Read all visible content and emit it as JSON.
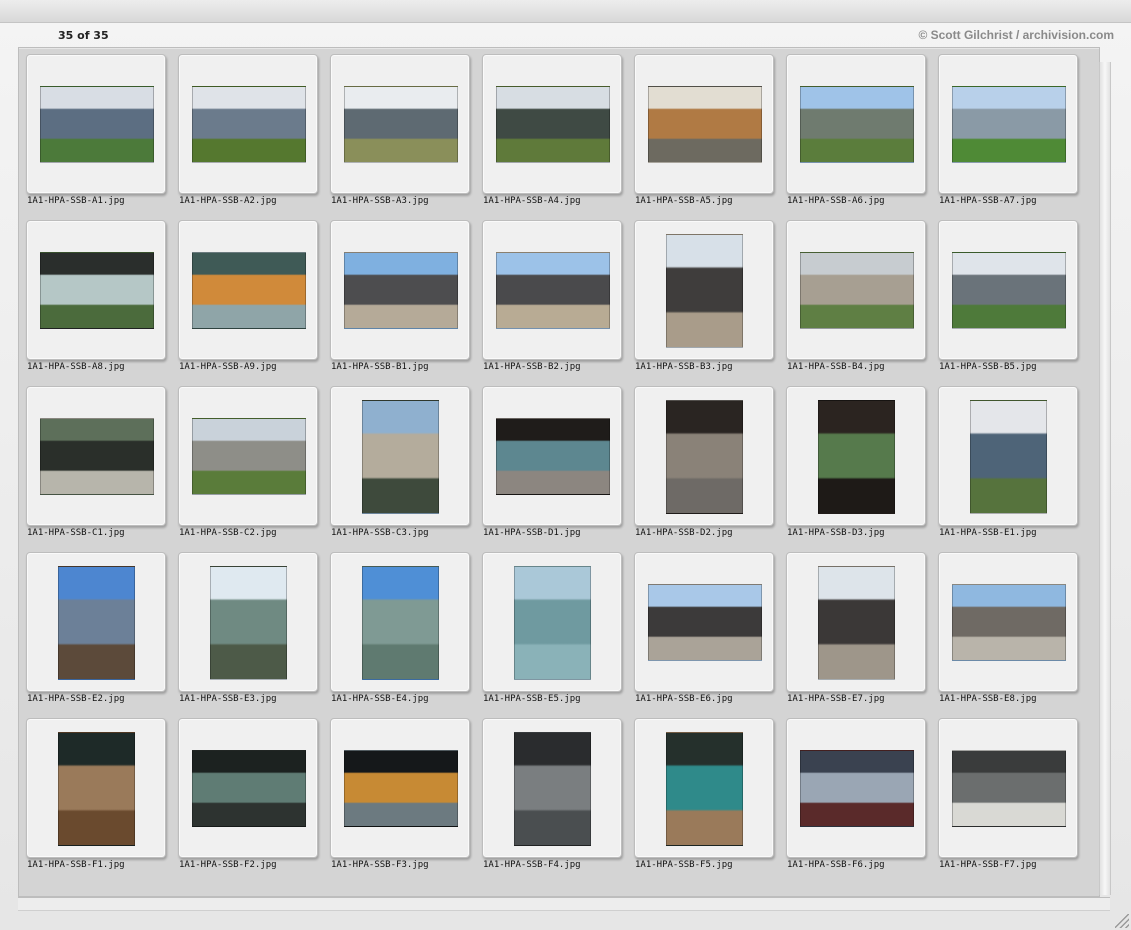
{
  "header": {
    "count": "35 of 35",
    "credit": "© Scott Gilchrist / archivision.com"
  },
  "items": [
    {
      "file": "1A1-HPA-SSB-A1.jpg",
      "orient": "landscape",
      "icon": "building-photo-icon",
      "c": [
        "#d8dde4",
        "#5c6e82",
        "#4c7a3a"
      ]
    },
    {
      "file": "1A1-HPA-SSB-A2.jpg",
      "orient": "landscape",
      "icon": "building-photo-icon",
      "c": [
        "#dfe3e8",
        "#6b7b8c",
        "#55782f"
      ]
    },
    {
      "file": "1A1-HPA-SSB-A3.jpg",
      "orient": "landscape",
      "icon": "walkway-photo-icon",
      "c": [
        "#e9ecef",
        "#5e6a72",
        "#8a8f5a"
      ]
    },
    {
      "file": "1A1-HPA-SSB-A4.jpg",
      "orient": "landscape",
      "icon": "walkway-photo-icon",
      "c": [
        "#d7dde3",
        "#3f4a44",
        "#5f7a3a"
      ]
    },
    {
      "file": "1A1-HPA-SSB-A5.jpg",
      "orient": "landscape",
      "icon": "corridor-photo-icon",
      "c": [
        "#e2ddd2",
        "#b07a44",
        "#6d6a60"
      ]
    },
    {
      "file": "1A1-HPA-SSB-A6.jpg",
      "orient": "landscape",
      "icon": "courtyard-photo-icon",
      "c": [
        "#9fc3e8",
        "#6f7b6f",
        "#5b7d3c"
      ]
    },
    {
      "file": "1A1-HPA-SSB-A7.jpg",
      "orient": "landscape",
      "icon": "courtyard-photo-icon",
      "c": [
        "#b8d0ea",
        "#8a9aa6",
        "#4f8a36"
      ]
    },
    {
      "file": "1A1-HPA-SSB-A8.jpg",
      "orient": "landscape",
      "icon": "interior-photo-icon",
      "c": [
        "#2a2e2c",
        "#b5c7c6",
        "#4b6b3c"
      ]
    },
    {
      "file": "1A1-HPA-SSB-A9.jpg",
      "orient": "landscape",
      "icon": "interior-photo-icon",
      "c": [
        "#3f5a56",
        "#d08a3a",
        "#8fa5a8"
      ]
    },
    {
      "file": "1A1-HPA-SSB-B1.jpg",
      "orient": "landscape",
      "icon": "building-photo-icon",
      "c": [
        "#7fb0e0",
        "#4d4d4f",
        "#b5aa98"
      ]
    },
    {
      "file": "1A1-HPA-SSB-B2.jpg",
      "orient": "landscape",
      "icon": "building-photo-icon",
      "c": [
        "#9cc2e8",
        "#4a4a4c",
        "#b8ab94"
      ]
    },
    {
      "file": "1A1-HPA-SSB-B3.jpg",
      "orient": "portrait",
      "icon": "building-photo-icon",
      "c": [
        "#d7e0e8",
        "#3f3d3c",
        "#a99c8a"
      ]
    },
    {
      "file": "1A1-HPA-SSB-B4.jpg",
      "orient": "landscape",
      "icon": "courtyard-photo-icon",
      "c": [
        "#c7ccd0",
        "#a79f92",
        "#5f7f44"
      ]
    },
    {
      "file": "1A1-HPA-SSB-B5.jpg",
      "orient": "landscape",
      "icon": "courtyard-photo-icon",
      "c": [
        "#dfe4ea",
        "#6a737a",
        "#4e7a3a"
      ]
    },
    {
      "file": "1A1-HPA-SSB-C1.jpg",
      "orient": "landscape",
      "icon": "walkway-photo-icon",
      "c": [
        "#5d6f5a",
        "#2a2f2a",
        "#b7b5ab"
      ]
    },
    {
      "file": "1A1-HPA-SSB-C2.jpg",
      "orient": "landscape",
      "icon": "walkway-photo-icon",
      "c": [
        "#c9d2da",
        "#8e8e88",
        "#5a7c3a"
      ]
    },
    {
      "file": "1A1-HPA-SSB-C3.jpg",
      "orient": "portrait",
      "icon": "building-photo-icon",
      "c": [
        "#8fb0cf",
        "#b4ac9c",
        "#3e4a3c"
      ]
    },
    {
      "file": "1A1-HPA-SSB-D1.jpg",
      "orient": "landscape",
      "icon": "building-photo-icon",
      "c": [
        "#1f1c1a",
        "#5d8790",
        "#8c8680"
      ]
    },
    {
      "file": "1A1-HPA-SSB-D2.jpg",
      "orient": "portrait",
      "icon": "corridor-photo-icon",
      "c": [
        "#2a2522",
        "#8a8278",
        "#6e6a66"
      ]
    },
    {
      "file": "1A1-HPA-SSB-D3.jpg",
      "orient": "portrait",
      "icon": "interior-photo-icon",
      "c": [
        "#2b2420",
        "#567a4c",
        "#1e1a17"
      ]
    },
    {
      "file": "1A1-HPA-SSB-E1.jpg",
      "orient": "portrait",
      "icon": "tower-photo-icon",
      "c": [
        "#e4e6ea",
        "#4e6478",
        "#56733d"
      ]
    },
    {
      "file": "1A1-HPA-SSB-E2.jpg",
      "orient": "portrait",
      "icon": "tower-photo-icon",
      "c": [
        "#4d86d0",
        "#6c8098",
        "#5c4a3a"
      ]
    },
    {
      "file": "1A1-HPA-SSB-E3.jpg",
      "orient": "portrait",
      "icon": "tower-photo-icon",
      "c": [
        "#dfe9f0",
        "#6f8a82",
        "#4d5a48"
      ]
    },
    {
      "file": "1A1-HPA-SSB-E4.jpg",
      "orient": "portrait",
      "icon": "tower-photo-icon",
      "c": [
        "#4f8fd6",
        "#7f9a94",
        "#5f7a70"
      ]
    },
    {
      "file": "1A1-HPA-SSB-E5.jpg",
      "orient": "portrait",
      "icon": "tower-photo-icon",
      "c": [
        "#aac8d8",
        "#6f9aa0",
        "#8ab2b8"
      ]
    },
    {
      "file": "1A1-HPA-SSB-E6.jpg",
      "orient": "landscape",
      "icon": "building-photo-icon",
      "c": [
        "#a9c8e8",
        "#3c3a3a",
        "#aaa398"
      ]
    },
    {
      "file": "1A1-HPA-SSB-E7.jpg",
      "orient": "portrait",
      "icon": "building-photo-icon",
      "c": [
        "#dde4ea",
        "#3b3837",
        "#9e968a"
      ]
    },
    {
      "file": "1A1-HPA-SSB-E8.jpg",
      "orient": "landscape",
      "icon": "building-photo-icon",
      "c": [
        "#8fb8e0",
        "#6f6a64",
        "#b9b4aa"
      ]
    },
    {
      "file": "1A1-HPA-SSB-F1.jpg",
      "orient": "portrait",
      "icon": "atrium-photo-icon",
      "c": [
        "#1e2a28",
        "#9a7a5a",
        "#6a4a2e"
      ]
    },
    {
      "file": "1A1-HPA-SSB-F2.jpg",
      "orient": "landscape",
      "icon": "atrium-photo-icon",
      "c": [
        "#1c2220",
        "#5f7c74",
        "#2d3330"
      ]
    },
    {
      "file": "1A1-HPA-SSB-F3.jpg",
      "orient": "landscape",
      "icon": "interior-photo-icon",
      "c": [
        "#15181a",
        "#c78a34",
        "#6c7a80"
      ]
    },
    {
      "file": "1A1-HPA-SSB-F4.jpg",
      "orient": "portrait",
      "icon": "interior-photo-icon",
      "c": [
        "#2a2c2e",
        "#7a7e80",
        "#4a4e50"
      ]
    },
    {
      "file": "1A1-HPA-SSB-F5.jpg",
      "orient": "portrait",
      "icon": "atrium-photo-icon",
      "c": [
        "#25302c",
        "#2f8a8a",
        "#9a7a5a"
      ]
    },
    {
      "file": "1A1-HPA-SSB-F6.jpg",
      "orient": "landscape",
      "icon": "corridor-photo-icon",
      "c": [
        "#3a4250",
        "#9aa6b4",
        "#5a2a2a"
      ]
    },
    {
      "file": "1A1-HPA-SSB-F7.jpg",
      "orient": "landscape",
      "icon": "interior-photo-icon",
      "c": [
        "#3a3c3c",
        "#6b6e6e",
        "#d9d9d4"
      ]
    }
  ]
}
